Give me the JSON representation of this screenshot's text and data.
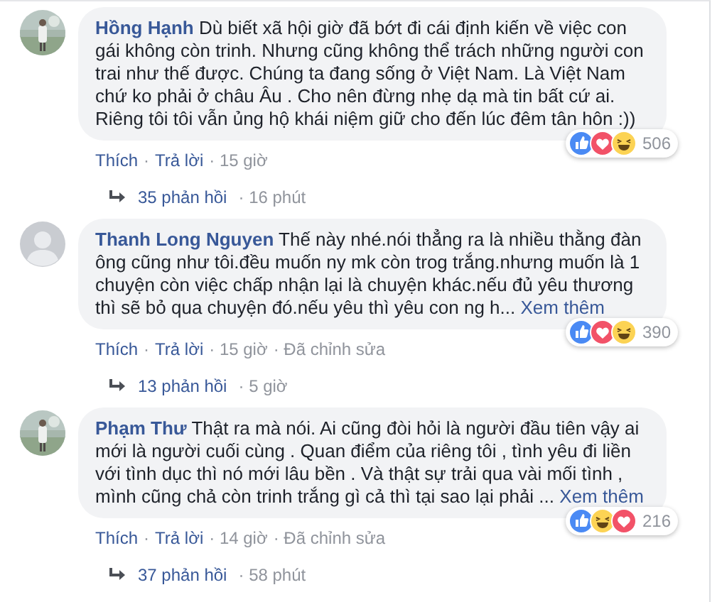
{
  "comments": [
    {
      "author": "Hồng Hạnh",
      "avatar": {
        "kind": "picture"
      },
      "text": "Dù biết xã hội giờ đã bớt đi cái định kiến về việc con gái không còn trinh. Nhưng cũng không thể trách những người con trai như thế được. Chúng ta đang sống ở Việt Nam. Là Việt Nam chứ ko phải ở châu Âu . Cho nên đừng nhẹ dạ mà tin bất cứ ai. Riêng tôi tôi vẫn ủng hộ khái niệm giữ cho đến lúc đêm tân hôn :))",
      "reactions": [
        {
          "kind": "like"
        },
        {
          "kind": "love"
        },
        {
          "kind": "haha"
        }
      ],
      "reaction_count": "506",
      "meta": [
        {
          "kind": "link",
          "text": "Thích"
        },
        {
          "kind": "separator",
          "text": "·"
        },
        {
          "kind": "link",
          "text": "Trả lời"
        },
        {
          "kind": "text",
          "text": "· 15 giờ"
        }
      ],
      "replies": {
        "count": "35 phản hồi",
        "time": "· 16 phút"
      }
    },
    {
      "author": "Thanh Long Nguyen",
      "avatar": {
        "kind": "default"
      },
      "text": "Thế này nhé.nói thẳng ra là nhiều thằng đàn ông cũng như tôi.đều muốn ny mk còn trog trắng.nhưng muốn là 1 chuyện còn việc chấp nhận lại là chuyện khác.nếu đủ yêu thương thì sẽ bỏ qua chuyện đó.nếu yêu thì yêu con ng h...",
      "see_more": "Xem thêm",
      "reactions": [
        {
          "kind": "like"
        },
        {
          "kind": "love"
        },
        {
          "kind": "haha"
        }
      ],
      "reaction_count": "390",
      "meta": [
        {
          "kind": "link",
          "text": "Thích"
        },
        {
          "kind": "separator",
          "text": "·"
        },
        {
          "kind": "link",
          "text": "Trả lời"
        },
        {
          "kind": "text",
          "text": "· 15 giờ"
        },
        {
          "kind": "text",
          "text": "· Đã chỉnh sửa"
        }
      ],
      "replies": {
        "count": "13 phản hồi",
        "time": "· 5 giờ"
      }
    },
    {
      "author": "Phạm Thư",
      "avatar": {
        "kind": "picture"
      },
      "text": "Thật ra mà nói. Ai cũng đòi hỏi là người đầu tiên vậy ai mới là người cuối cùng . Quan điểm của riêng tôi , tình yêu đi liền với tình dục thì nó mới lâu bền . Và thật sự trải qua vài mối tình , mình cũng chả còn trinh trắng gì cả thì tại sao lại phải ...",
      "see_more": "Xem thêm",
      "reactions": [
        {
          "kind": "like"
        },
        {
          "kind": "haha"
        },
        {
          "kind": "love"
        }
      ],
      "reaction_count": "216",
      "meta": [
        {
          "kind": "link",
          "text": "Thích"
        },
        {
          "kind": "separator",
          "text": "·"
        },
        {
          "kind": "link",
          "text": "Trả lời"
        },
        {
          "kind": "text",
          "text": "· 14 giờ"
        },
        {
          "kind": "text",
          "text": "· Đã chỉnh sửa"
        }
      ],
      "replies": {
        "count": "37 phản hồi",
        "time": "· 58 phút"
      }
    }
  ]
}
